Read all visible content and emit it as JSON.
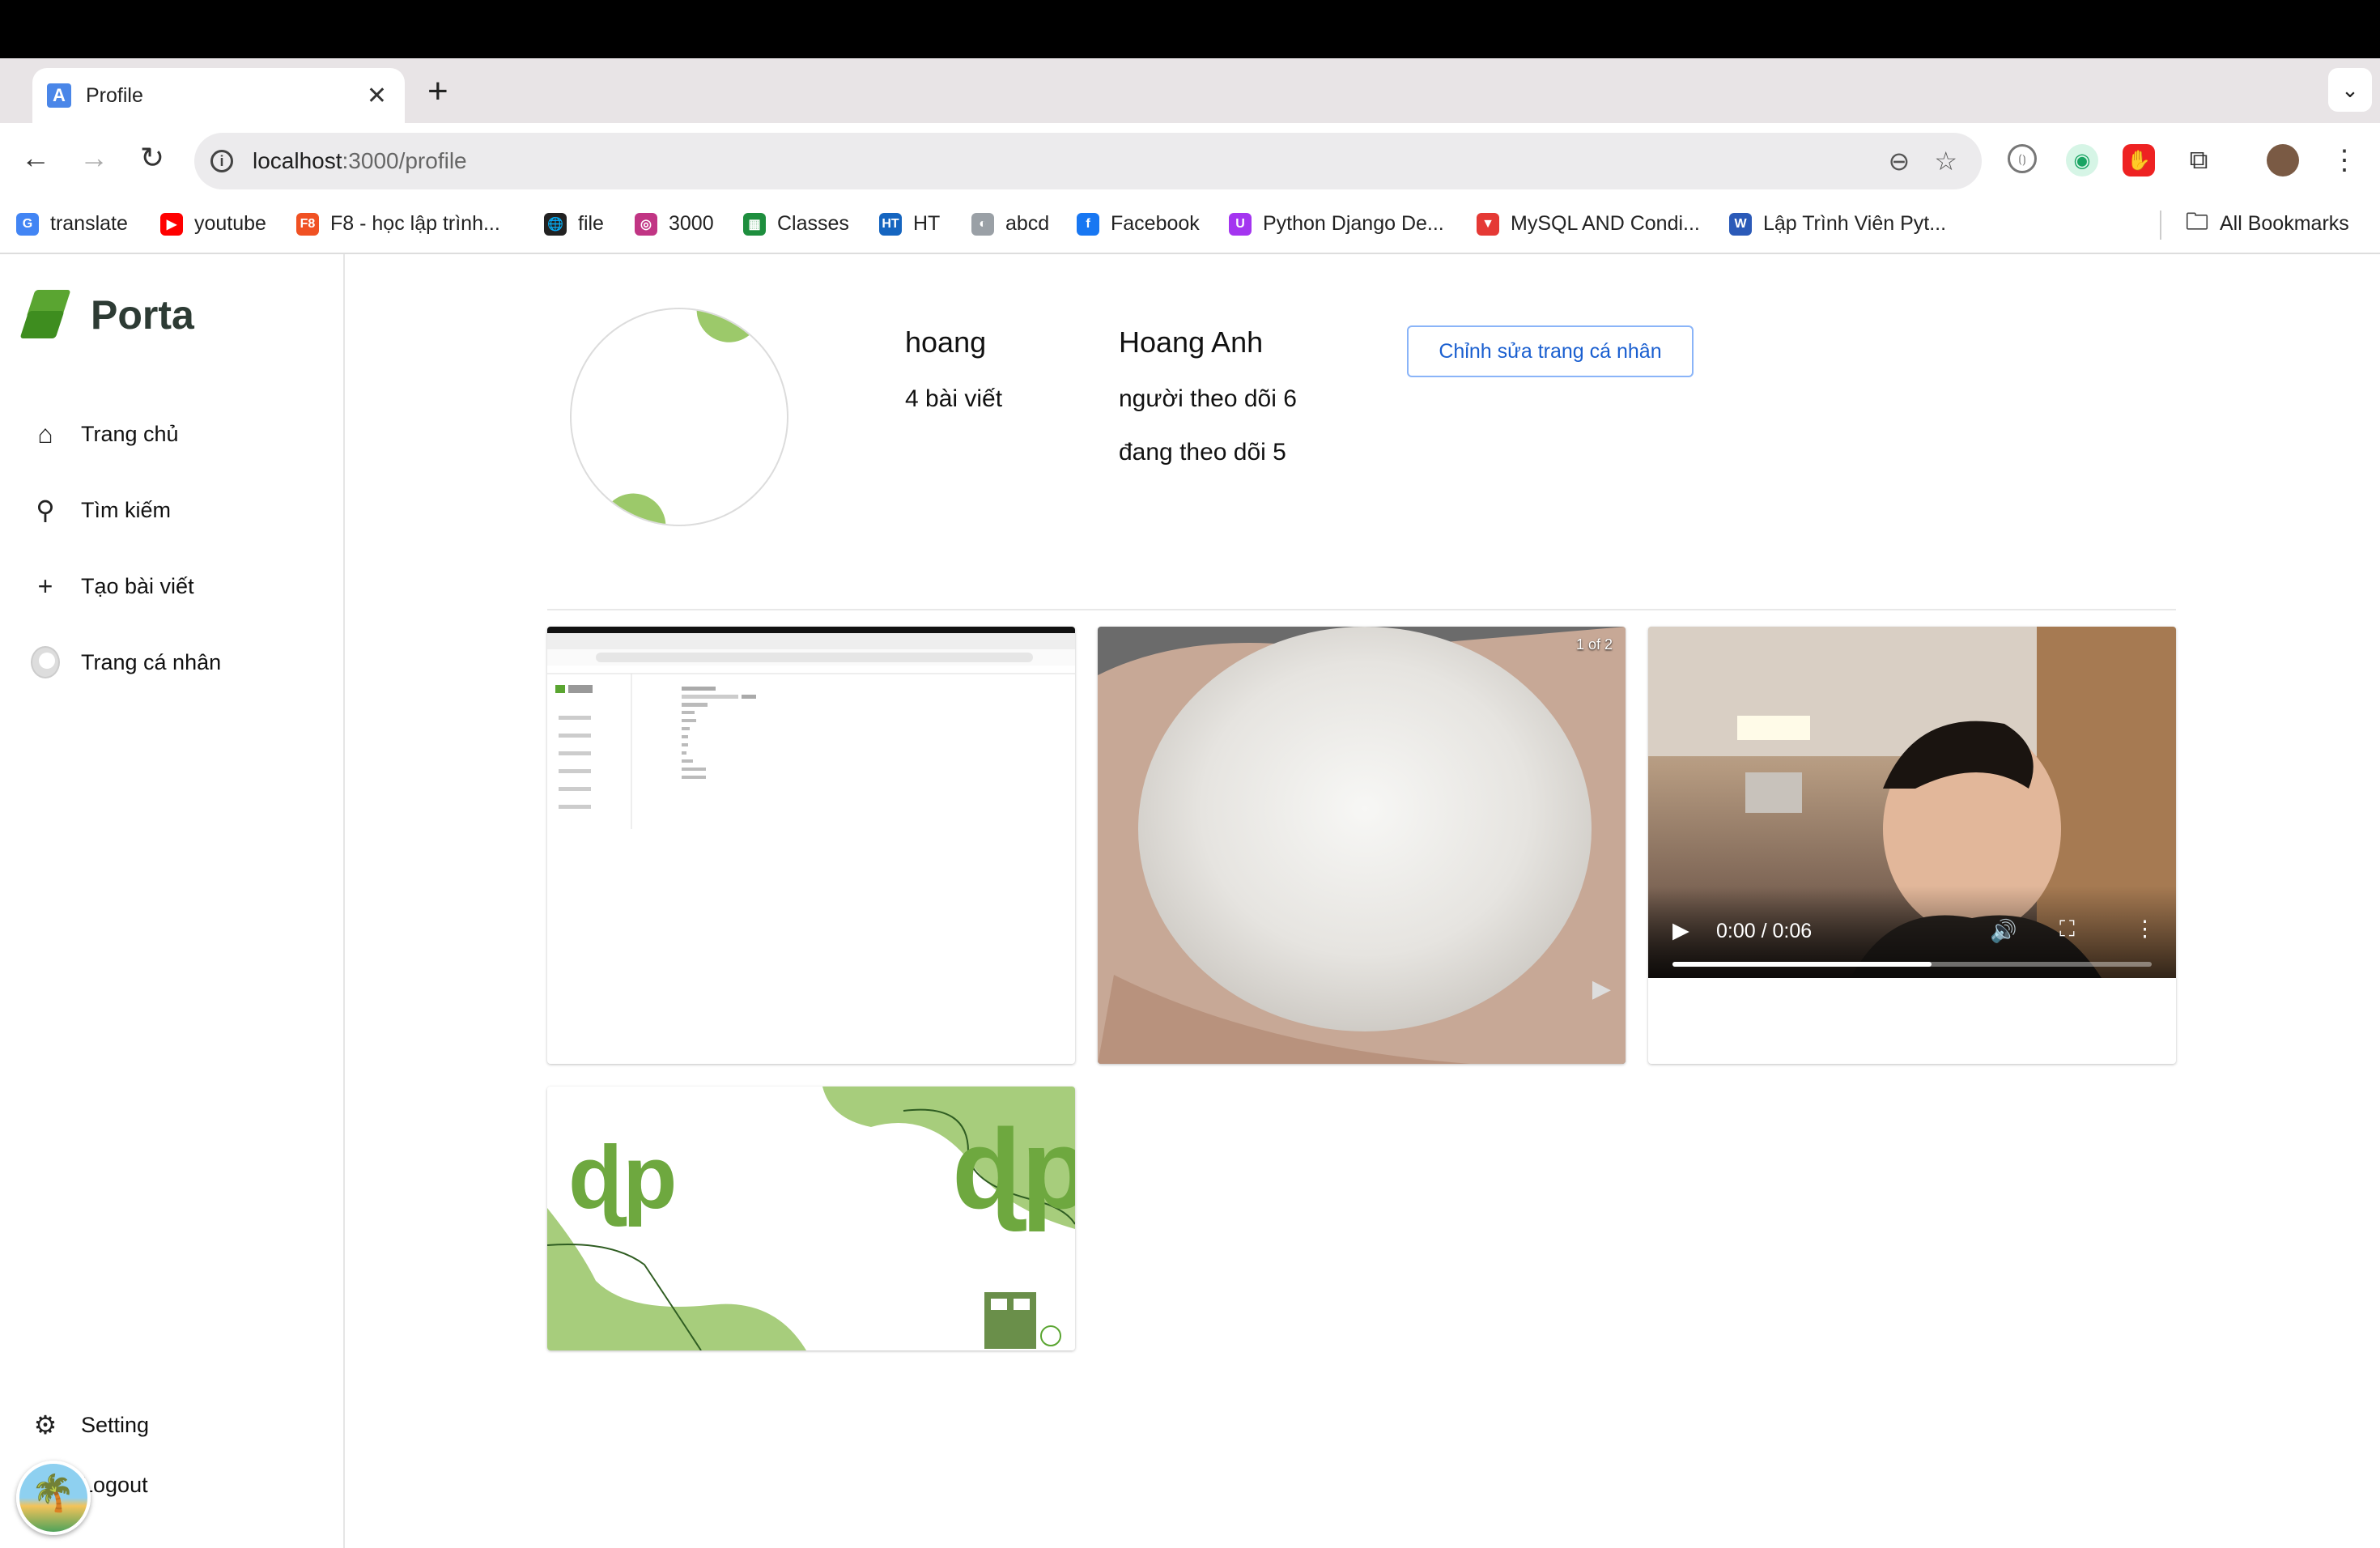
{
  "browser": {
    "tab_title": "Profile",
    "tab_favicon": "A",
    "url_host": "localhost",
    "url_path": ":3000/profile",
    "bookmarks": [
      {
        "label": "translate",
        "icon": "google-translate-icon",
        "color": "#4285f4",
        "glyph": "G"
      },
      {
        "label": "youtube",
        "icon": "youtube-icon",
        "color": "#ff0000",
        "glyph": "▶"
      },
      {
        "label": "F8 - học lập trình...",
        "icon": "f8-icon",
        "color": "#f05123",
        "glyph": "F8"
      },
      {
        "label": "file",
        "icon": "globe-icon",
        "color": "#222222",
        "glyph": "🌐"
      },
      {
        "label": "3000",
        "icon": "instagram-icon",
        "color": "#c13584",
        "glyph": "◎"
      },
      {
        "label": "Classes",
        "icon": "classroom-icon",
        "color": "#1e8e3e",
        "glyph": "▦"
      },
      {
        "label": "HT",
        "icon": "ht-icon",
        "color": "#1565c0",
        "glyph": "HT"
      },
      {
        "label": "abcd",
        "icon": "abcd-icon",
        "color": "#9aa0a6",
        "glyph": "◐"
      },
      {
        "label": "Facebook",
        "icon": "facebook-icon",
        "color": "#1877f2",
        "glyph": "f"
      },
      {
        "label": "Python Django De...",
        "icon": "udemy-icon",
        "color": "#a435f0",
        "glyph": "U"
      },
      {
        "label": "MySQL AND Condi...",
        "icon": "mysql-icon",
        "color": "#e53935",
        "glyph": "▼"
      },
      {
        "label": "Lập Trình Viên Pyt...",
        "icon": "w3-icon",
        "color": "#2b5ab8",
        "glyph": "W"
      }
    ],
    "all_bookmarks": "All Bookmarks"
  },
  "sidebar": {
    "logo": "Porta",
    "items": [
      {
        "label": "Trang chủ",
        "icon": "home-icon",
        "glyph": "⌂"
      },
      {
        "label": "Tìm kiếm",
        "icon": "search-icon",
        "glyph": "⚲"
      },
      {
        "label": "Tạo bài viết",
        "icon": "plus-icon",
        "glyph": "+"
      },
      {
        "label": "Trang cá nhân",
        "icon": "avatar-icon",
        "glyph": ""
      }
    ],
    "setting": "Setting",
    "logout": "Logout"
  },
  "profile": {
    "username": "hoang",
    "posts": "4 bài viết",
    "full_name": "Hoang Anh",
    "followers": "người theo dõi 6",
    "following": "đang theo dõi 5",
    "edit_button": "Chỉnh sửa trang cá nhân"
  },
  "posts": {
    "carousel_counter": "1 of 2",
    "video_time": "0:00 / 0:06",
    "video_progress": 0.54
  },
  "colors": {
    "brand_green": "#5aa531",
    "accent_blue": "#1a5fd0"
  }
}
